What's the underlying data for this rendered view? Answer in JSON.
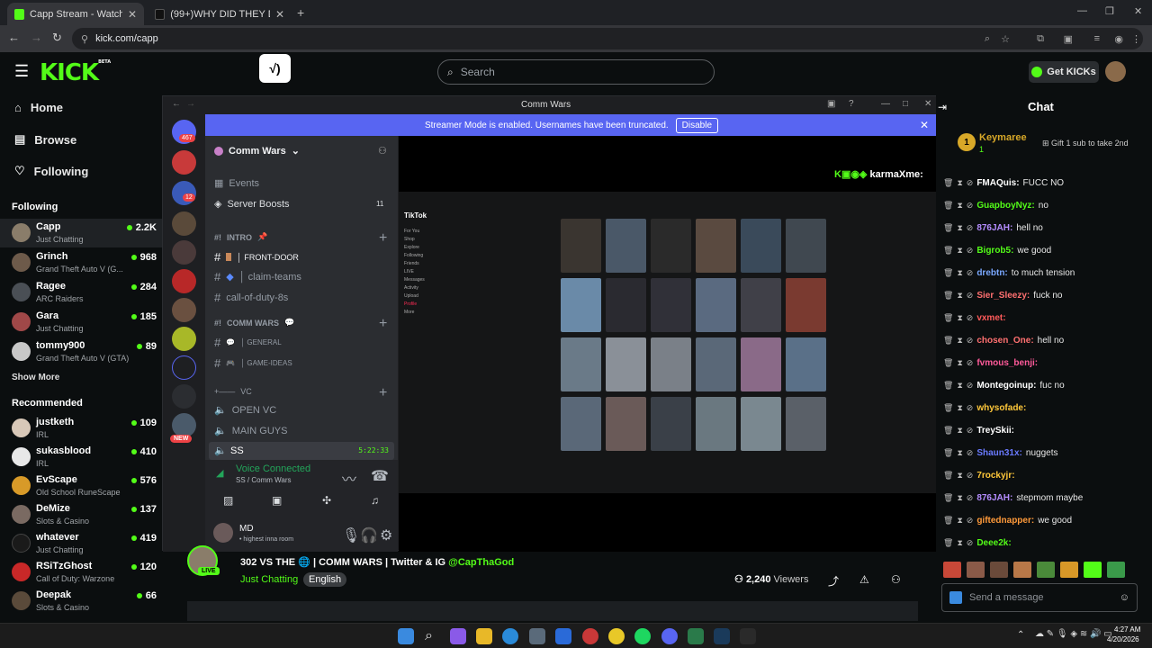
{
  "browser": {
    "tabs": [
      {
        "label": "Capp Stream - Watch Live on K",
        "close": "✕"
      },
      {
        "label": "(99+)WHY DID THEY DO BOY I",
        "close": "✕"
      }
    ],
    "new_tab": "+",
    "url": "kick.com/capp"
  },
  "kick": {
    "logo": "KICK",
    "logo_badge": "BETA",
    "search_placeholder": "Search",
    "get_kicks": "Get KICKs",
    "nav": [
      "Home",
      "Browse",
      "Following"
    ],
    "following_label": "Following",
    "following": [
      {
        "name": "Capp",
        "category": "Just Chatting",
        "viewers": "2.2K",
        "color": "#8a7d6a"
      },
      {
        "name": "Grinch",
        "category": "Grand Theft Auto V (G...",
        "viewers": "968",
        "color": "#6d5a4a"
      },
      {
        "name": "Ragee",
        "category": "ARC Raiders",
        "viewers": "284",
        "color": "#4a4f55"
      },
      {
        "name": "Gara",
        "category": "Just Chatting",
        "viewers": "185",
        "color": "#a04848"
      },
      {
        "name": "tommy900",
        "category": "Grand Theft Auto V (GTA)",
        "viewers": "89",
        "color": "#c8c8c8"
      }
    ],
    "show_more": "Show More",
    "recommended_label": "Recommended",
    "recommended": [
      {
        "name": "justketh",
        "category": "IRL",
        "viewers": "109",
        "color": "#d8c8b8"
      },
      {
        "name": "sukasblood",
        "category": "IRL",
        "viewers": "410",
        "color": "#e8e8e8"
      },
      {
        "name": "EvScape",
        "category": "Old School RuneScape",
        "viewers": "576",
        "color": "#d89a28"
      },
      {
        "name": "DeMize",
        "category": "Slots & Casino",
        "viewers": "137",
        "color": "#7a6a62"
      },
      {
        "name": "whatever",
        "category": "Just Chatting",
        "viewers": "419",
        "color": "#1a1a1a"
      },
      {
        "name": "RSiTzGhost",
        "category": "Call of Duty: Warzone",
        "viewers": "120",
        "color": "#c82828"
      },
      {
        "name": "Deepak",
        "category": "Slots & Casino",
        "viewers": "66",
        "color": "#5a4a3a"
      }
    ]
  },
  "discord": {
    "window_title": "Comm Wars",
    "streamer_mode": "Streamer Mode is enabled. Usernames have been truncated.",
    "disable_btn": "Disable",
    "server_name": "Comm Wars",
    "badges": {
      "dm": "467",
      "srv2": "12",
      "new": "NEW"
    },
    "events": "Events",
    "server_boosts": "Server Boosts",
    "boost_count": "11",
    "cat_intro": "INTRO",
    "ch_front_door": "│ FRONT-DOOR",
    "ch_claim": "│ claim-teams",
    "ch_cod": "call-of-duty-8s",
    "cat_comm": "COMM WARS",
    "ch_general": "│ GENERAL",
    "ch_ideas": "│ GAME-IDEAS",
    "cat_vc": "VC",
    "vc_open": "OPEN VC",
    "vc_main": "MAIN GUYS",
    "vc_ss": "SS",
    "vc_time": "5:22:33",
    "voice_connected": "Voice Connected",
    "voice_sub": "SS / Comm Wars",
    "user_name": "MD",
    "user_status": "• highest inna room",
    "tiktok": {
      "brand": "TikTok",
      "menu": [
        "For You",
        "Shop",
        "Explore",
        "Following",
        "Friends",
        "LIVE",
        "Messages",
        "Activity",
        "Upload",
        "Profile",
        "More"
      ]
    },
    "karma_user": "karmaXme:"
  },
  "stream": {
    "title": "302 VS THE 🌐 | COMM WARS | Twitter & IG",
    "handle": "@CapThaGod",
    "category": "Just Chatting",
    "language": "English",
    "viewers": "2,240",
    "viewers_label": "Viewers",
    "live": "LIVE"
  },
  "chat": {
    "header": "Chat",
    "gift_user": "Keymaree",
    "gift_count": "1",
    "gift_text": "Gift 1 sub to take 2nd",
    "messages": [
      {
        "user": "FMAQuis",
        "text": "FUCC NO",
        "color": "#ffffff"
      },
      {
        "user": "GuapboyNyz",
        "text": "no",
        "color": "#53fc18"
      },
      {
        "user": "876JAH",
        "text": "hell no",
        "color": "#b48cff"
      },
      {
        "user": "Bigrob5",
        "text": "we good",
        "color": "#53fc18"
      },
      {
        "user": "drebtn",
        "text": "to much tension",
        "color": "#7aa8ff"
      },
      {
        "user": "Sier_Sleezy",
        "text": "fuck no",
        "color": "#ff7070"
      },
      {
        "user": "vxmet",
        "text": "",
        "color": "#ff5a5a"
      },
      {
        "user": "chosen_One",
        "text": "hell no",
        "color": "#ff7070"
      },
      {
        "user": "fvmous_benji",
        "text": "",
        "color": "#ff5a9a"
      },
      {
        "user": "Montegoinup",
        "text": "fuc no",
        "color": "#ffffff"
      },
      {
        "user": "whysofade",
        "text": "",
        "color": "#ffc83a"
      },
      {
        "user": "TreySkii",
        "text": "",
        "color": "#ffffff"
      },
      {
        "user": "Shaun31x",
        "text": "nuggets",
        "color": "#6a7aff"
      },
      {
        "user": "7rockyjr",
        "text": "",
        "color": "#ffc83a"
      },
      {
        "user": "876JAH",
        "text": "stepmom maybe",
        "color": "#b48cff"
      },
      {
        "user": "giftednapper",
        "text": "we good",
        "color": "#ff9a3a"
      },
      {
        "user": "Deee2k",
        "text": "",
        "color": "#53fc18"
      }
    ],
    "send_placeholder": "Send a message"
  },
  "taskbar": {
    "time": "4:27 AM",
    "date": "4/20/2026"
  }
}
